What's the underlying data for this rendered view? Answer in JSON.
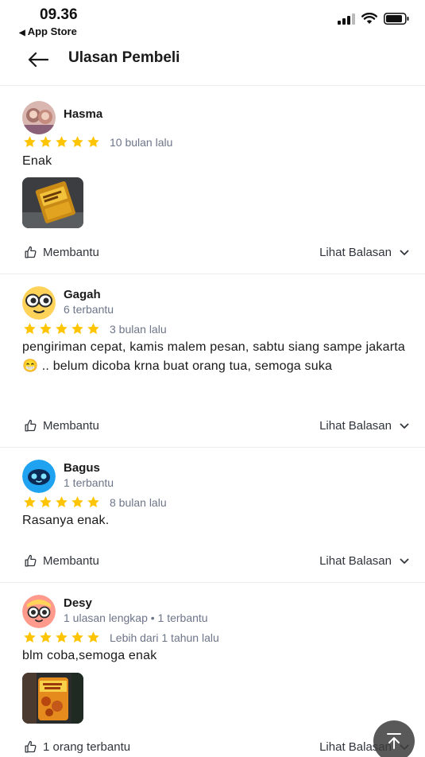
{
  "status_bar": {
    "time": "09.36",
    "back_app": "App Store"
  },
  "header": {
    "title": "Ulasan Pembeli"
  },
  "colors": {
    "star": "#FFC400",
    "text": "#212121",
    "muted": "#6D7588"
  },
  "reviews": [
    {
      "name": "Hasma",
      "meta": "",
      "rating": 5,
      "date": "10 bulan lalu",
      "text": "Enak",
      "has_photo": true,
      "helpful_label": "Membantu",
      "reply_label": "Lihat Balasan",
      "avatar_icon": "photo-avatar"
    },
    {
      "name": "Gagah",
      "meta": "6 terbantu",
      "rating": 5,
      "date": "3 bulan lalu",
      "text": "pengiriman cepat, kamis malem pesan, sabtu siang sampe jakarta 😁 .. belum dicoba krna buat orang tua, semoga suka",
      "has_photo": false,
      "helpful_label": "Membantu",
      "reply_label": "Lihat Balasan",
      "avatar_icon": "yellow-face-avatar"
    },
    {
      "name": "Bagus",
      "meta": "1 terbantu",
      "rating": 5,
      "date": "8 bulan lalu",
      "text": "Rasanya enak.",
      "has_photo": false,
      "helpful_label": "Membantu",
      "reply_label": "Lihat Balasan",
      "avatar_icon": "blue-face-avatar"
    },
    {
      "name": "Desy",
      "meta": "1 ulasan lengkap • 1 terbantu",
      "rating": 5,
      "date": "Lebih dari 1 tahun lalu",
      "text": "blm coba,semoga enak",
      "has_photo": true,
      "helpful_label": "1 orang terbantu",
      "reply_label": "Lihat Balasan",
      "avatar_icon": "pink-face-avatar"
    }
  ]
}
